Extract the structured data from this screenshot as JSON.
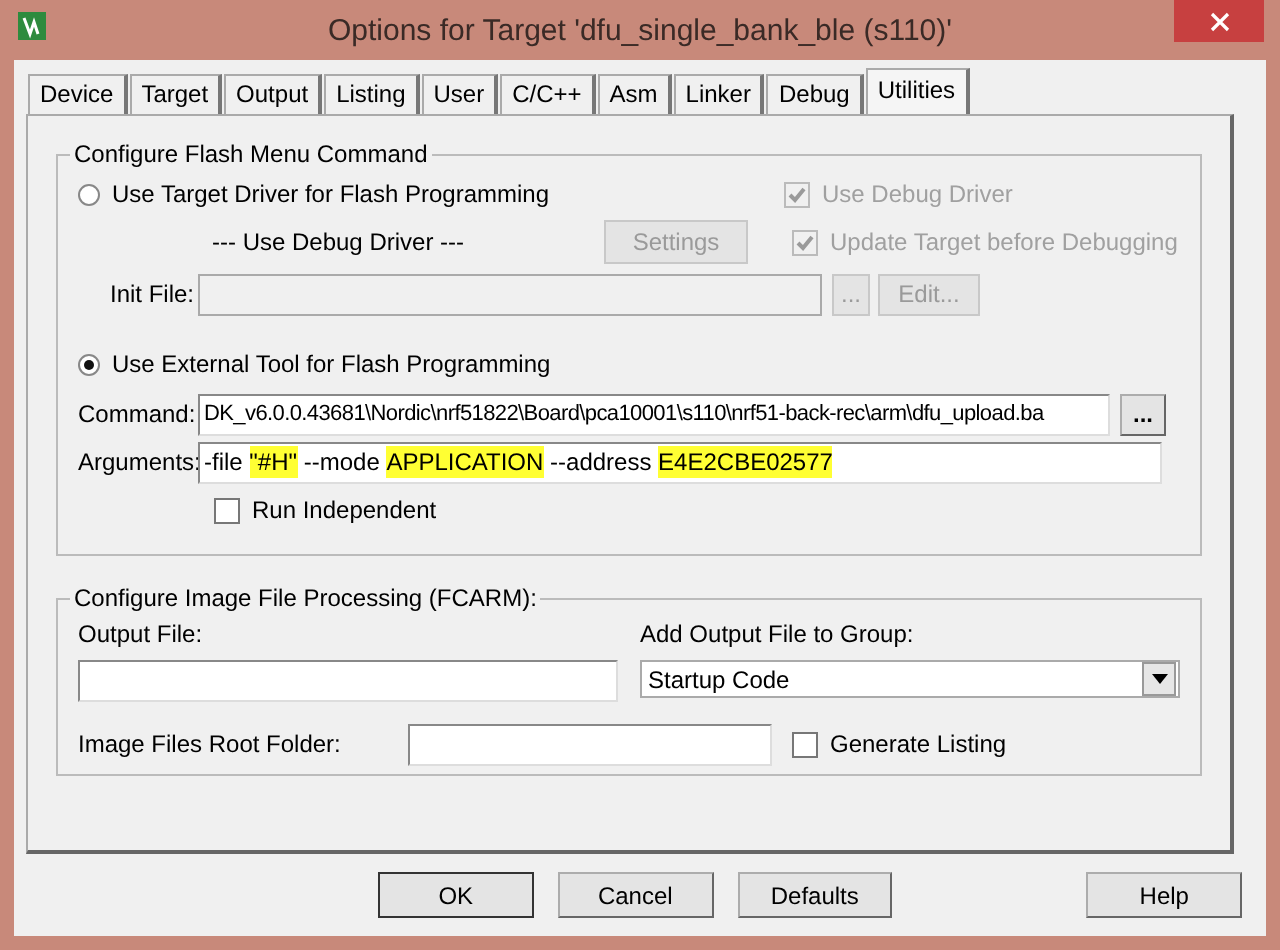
{
  "window": {
    "title": "Options for Target 'dfu_single_bank_ble (s110)'"
  },
  "tabs": [
    {
      "label": "Device",
      "selected": false
    },
    {
      "label": "Target",
      "selected": false
    },
    {
      "label": "Output",
      "selected": false
    },
    {
      "label": "Listing",
      "selected": false
    },
    {
      "label": "User",
      "selected": false
    },
    {
      "label": "C/C++",
      "selected": false
    },
    {
      "label": "Asm",
      "selected": false
    },
    {
      "label": "Linker",
      "selected": false
    },
    {
      "label": "Debug",
      "selected": false
    },
    {
      "label": "Utilities",
      "selected": true
    }
  ],
  "flash_group": {
    "title": "Configure Flash Menu Command",
    "options": [
      {
        "label": "Use Target Driver for Flash Programming",
        "selected": false
      },
      {
        "label": "Use External Tool for Flash Programming",
        "selected": true
      }
    ],
    "driver_label": "--- Use Debug Driver ---",
    "settings_button": {
      "label": "Settings",
      "disabled": true
    },
    "checkboxes": [
      {
        "label": "Use Debug Driver",
        "checked": true,
        "disabled": true
      },
      {
        "label": "Update Target before Debugging",
        "checked": true,
        "disabled": true
      }
    ],
    "init_file": {
      "label": "Init File:",
      "disabled": true,
      "browse": "...",
      "edit": "Edit..."
    },
    "command": {
      "label": "Command:",
      "value": "DK_v6.0.0.43681\\Nordic\\nrf51822\\Board\\pca10001\\s110\\nrf51-back-rec\\arm\\dfu_upload.ba",
      "browse": "..."
    },
    "arguments": {
      "label": "Arguments:",
      "segments": [
        {
          "text": "-file ",
          "highlight": false
        },
        {
          "text": "\"#H\"",
          "highlight": true
        },
        {
          "text": " --mode ",
          "highlight": false
        },
        {
          "text": "APPLICATION",
          "highlight": true
        },
        {
          "text": " --address ",
          "highlight": false
        },
        {
          "text": "E4E2CBE02577",
          "highlight": true
        }
      ]
    },
    "run_independent": {
      "label": "Run Independent",
      "checked": false
    }
  },
  "image_group": {
    "title": "Configure Image File Processing (FCARM):",
    "output_file": {
      "label": "Output File:"
    },
    "group": {
      "label": "Add Output File  to Group:",
      "value": "Startup Code"
    },
    "root_folder": {
      "label": "Image Files Root Folder:"
    },
    "generate_listing": {
      "label": "Generate Listing",
      "checked": false
    }
  },
  "buttons": [
    {
      "label": "OK",
      "kind": "default"
    },
    {
      "label": "Cancel",
      "kind": "normal"
    },
    {
      "label": "Defaults",
      "kind": "normal"
    },
    {
      "label": "Help",
      "kind": "help"
    }
  ]
}
